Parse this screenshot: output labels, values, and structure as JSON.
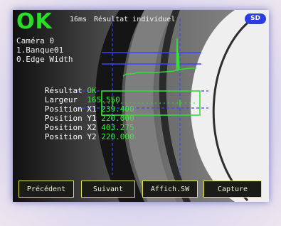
{
  "status": {
    "ok_label": "OK",
    "time": "16ms",
    "title": "Résultat individuel",
    "badge": "SD"
  },
  "info": {
    "camera": "Caméra 0",
    "bank": "1.Banque01",
    "tool": "0.Edge Width"
  },
  "results": [
    {
      "label": "Résultat",
      "value": "OK"
    },
    {
      "label": "Largeur",
      "value": "165.550"
    },
    {
      "label": "Position X1",
      "value": "239.400"
    },
    {
      "label": "Position Y1",
      "value": "220.000"
    },
    {
      "label": "Position X2",
      "value": "403.275"
    },
    {
      "label": "Position Y2",
      "value": "220.000"
    }
  ],
  "buttons": [
    {
      "label": "Précédent"
    },
    {
      "label": "Suivant"
    },
    {
      "label": "Affich.SW"
    },
    {
      "label": "Capture"
    }
  ],
  "colors": {
    "ok": "#25e025",
    "button_border": "#e6e24a",
    "badge": "#2b3de0",
    "overlay_blue": "#3f43ff"
  }
}
